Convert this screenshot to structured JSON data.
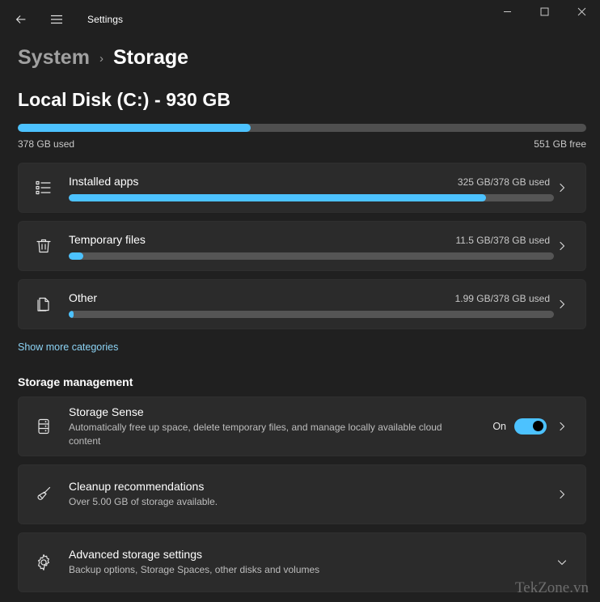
{
  "titlebar": {
    "app_title": "Settings",
    "back_icon": "back-arrow-icon",
    "menu_icon": "hamburger-menu-icon",
    "minimize_icon": "minimize-icon",
    "maximize_icon": "maximize-icon",
    "close_icon": "close-icon"
  },
  "breadcrumb": {
    "parent": "System",
    "separator": "›",
    "current": "Storage"
  },
  "disk": {
    "title": "Local Disk (C:) - 930 GB",
    "used_label": "378 GB used",
    "free_label": "551 GB free",
    "used_percent": 41,
    "total_gb": 930,
    "used_gb": 378,
    "free_gb": 551
  },
  "categories": [
    {
      "name": "Installed apps",
      "usage": "325 GB/378 GB used",
      "percent": 86,
      "icon": "installed-apps-list-icon"
    },
    {
      "name": "Temporary files",
      "usage": "11.5 GB/378 GB used",
      "percent": 3,
      "icon": "trash-can-icon"
    },
    {
      "name": "Other",
      "usage": "1.99 GB/378 GB used",
      "percent": 1,
      "icon": "documents-stack-icon"
    }
  ],
  "show_more_label": "Show more categories",
  "management": {
    "heading": "Storage management",
    "items": [
      {
        "title": "Storage Sense",
        "desc": "Automatically free up space, delete temporary files, and manage locally available cloud content",
        "icon": "storage-drive-icon",
        "toggle_state": "On",
        "chevron": "chevron-right-icon"
      },
      {
        "title": "Cleanup recommendations",
        "desc": "Over 5.00 GB of storage available.",
        "icon": "broom-icon",
        "chevron": "chevron-right-icon"
      },
      {
        "title": "Advanced storage settings",
        "desc": "Backup options, Storage Spaces, other disks and volumes",
        "icon": "gear-icon",
        "chevron": "chevron-down-icon"
      }
    ]
  },
  "watermark": "TekZone.vn",
  "colors": {
    "accent": "#4cc2ff",
    "page_bg": "#202020",
    "card_bg": "#2b2b2b",
    "track": "#555555",
    "link": "#8cd3f5"
  }
}
